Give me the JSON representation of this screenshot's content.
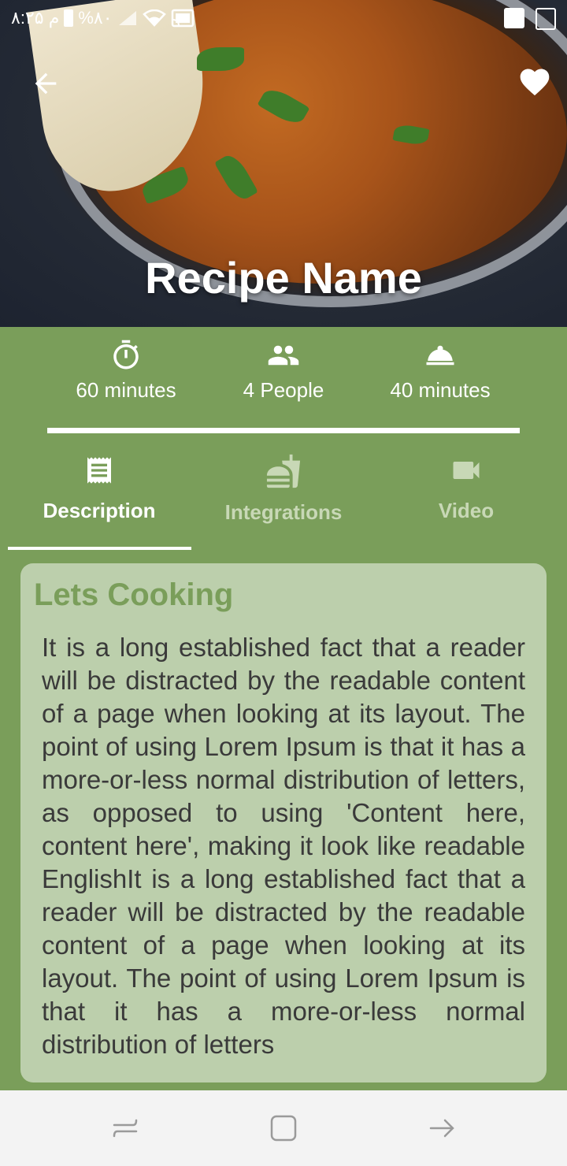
{
  "status_bar": {
    "time": "۸:۲۵ م",
    "battery": "%۸۰"
  },
  "header": {
    "title": "Recipe Name",
    "icons": {
      "back": "arrow-back-icon",
      "favorite": "heart-icon"
    }
  },
  "stats": [
    {
      "icon": "timer-icon",
      "label": "60 minutes"
    },
    {
      "icon": "people-icon",
      "label": "4 People"
    },
    {
      "icon": "serving-bell-icon",
      "label": "40 minutes"
    }
  ],
  "tabs": [
    {
      "icon": "receipt-icon",
      "label": "Description",
      "active": true
    },
    {
      "icon": "fastfood-icon",
      "label": "Integrations",
      "active": false
    },
    {
      "icon": "video-camera-icon",
      "label": "Video",
      "active": false
    }
  ],
  "card": {
    "title": "Lets Cooking",
    "body": "It is a long established fact that a reader will be distracted by the readable content of a page when looking at its layout. The point of using Lorem Ipsum is that it has a more-or-less normal distribution of letters, as opposed to using 'Content here, content here', making it look like readable EnglishIt is a long established fact that a reader will be distracted by the readable content of a page when looking at its layout. The point of using Lorem Ipsum is that it has a more-or-less normal distribution of letters"
  },
  "colors": {
    "background": "#7a9e5a",
    "card": "#bccfac",
    "card_title": "#7a9e5a",
    "active_tab": "#ffffff",
    "inactive_tab": "#c8d8b6"
  }
}
